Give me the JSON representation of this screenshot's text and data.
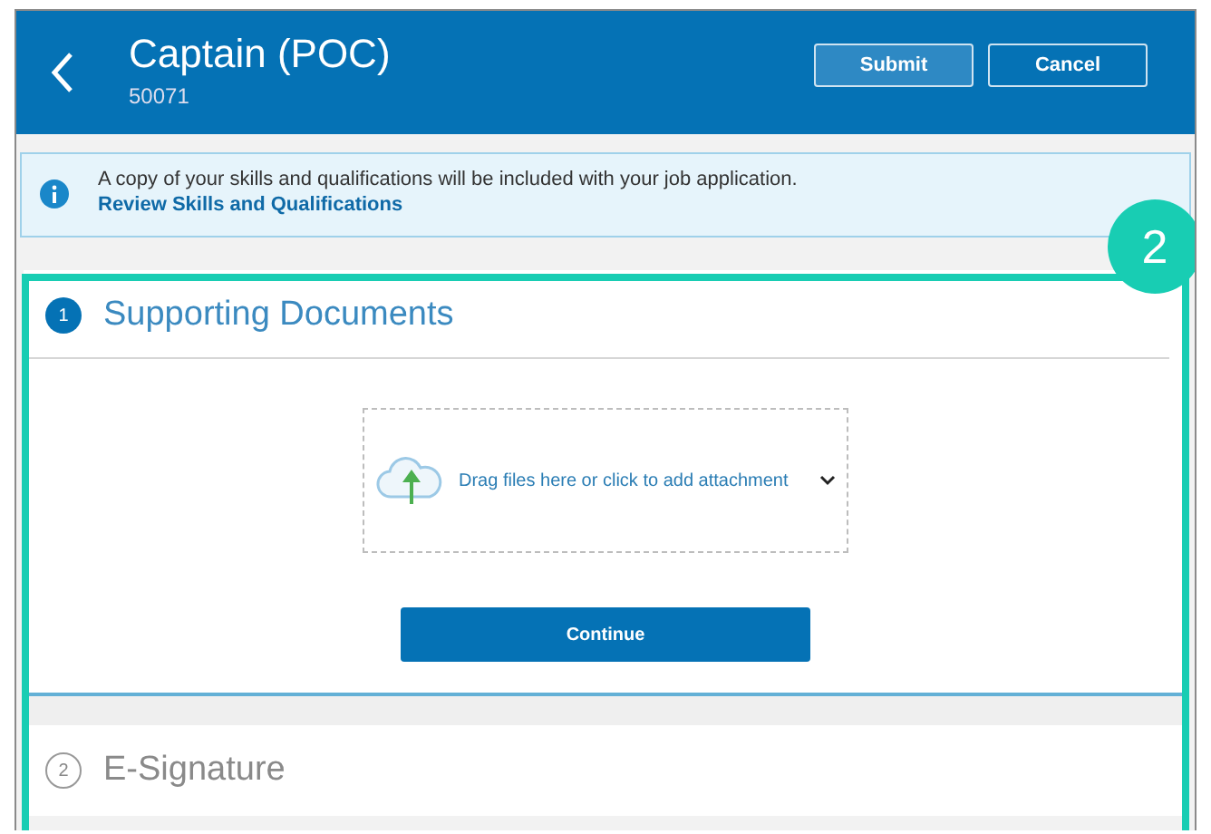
{
  "header": {
    "title": "Captain (POC)",
    "subtitle": "50071",
    "buttons": [
      {
        "label": "Submit",
        "kind": "primary"
      },
      {
        "label": "Cancel",
        "kind": "secondary"
      }
    ]
  },
  "info_banner": {
    "message": "A copy of your skills and qualifications will be included with your job application.",
    "link": "Review Skills and Qualifications"
  },
  "callout": {
    "number": "2"
  },
  "steps": [
    {
      "number": "1",
      "title": "Supporting Documents",
      "active": true,
      "upload": {
        "label": "Drag files here or click to add attachment"
      },
      "button": "Continue"
    },
    {
      "number": "2",
      "title": "E-Signature",
      "active": false
    }
  ]
}
